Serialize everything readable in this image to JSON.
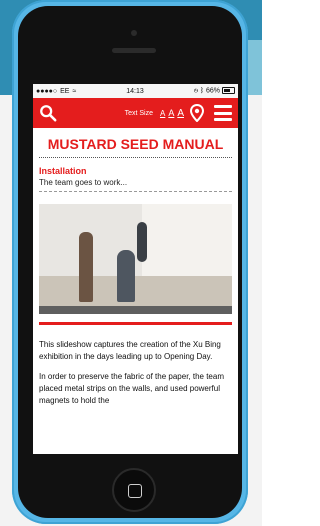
{
  "status_bar": {
    "carrier": "EE",
    "time": "14:13",
    "battery": "66%"
  },
  "appbar": {
    "text_size_label": "Text Size",
    "size_small": "A",
    "size_medium": "A",
    "size_large": "A"
  },
  "page": {
    "title": "MUSTARD SEED MANUAL",
    "section_heading": "Installation",
    "section_subtitle": "The team goes to work...",
    "paragraph1": "This slideshow captures the creation of the Xu Bing exhibition in the days leading up to Opening Day.",
    "paragraph2": "In order to preserve the fabric of the paper, the team placed metal strips on the walls, and used powerful magnets to hold the"
  },
  "colors": {
    "accent": "#e41d1d",
    "phone_body": "#56b6e6"
  }
}
